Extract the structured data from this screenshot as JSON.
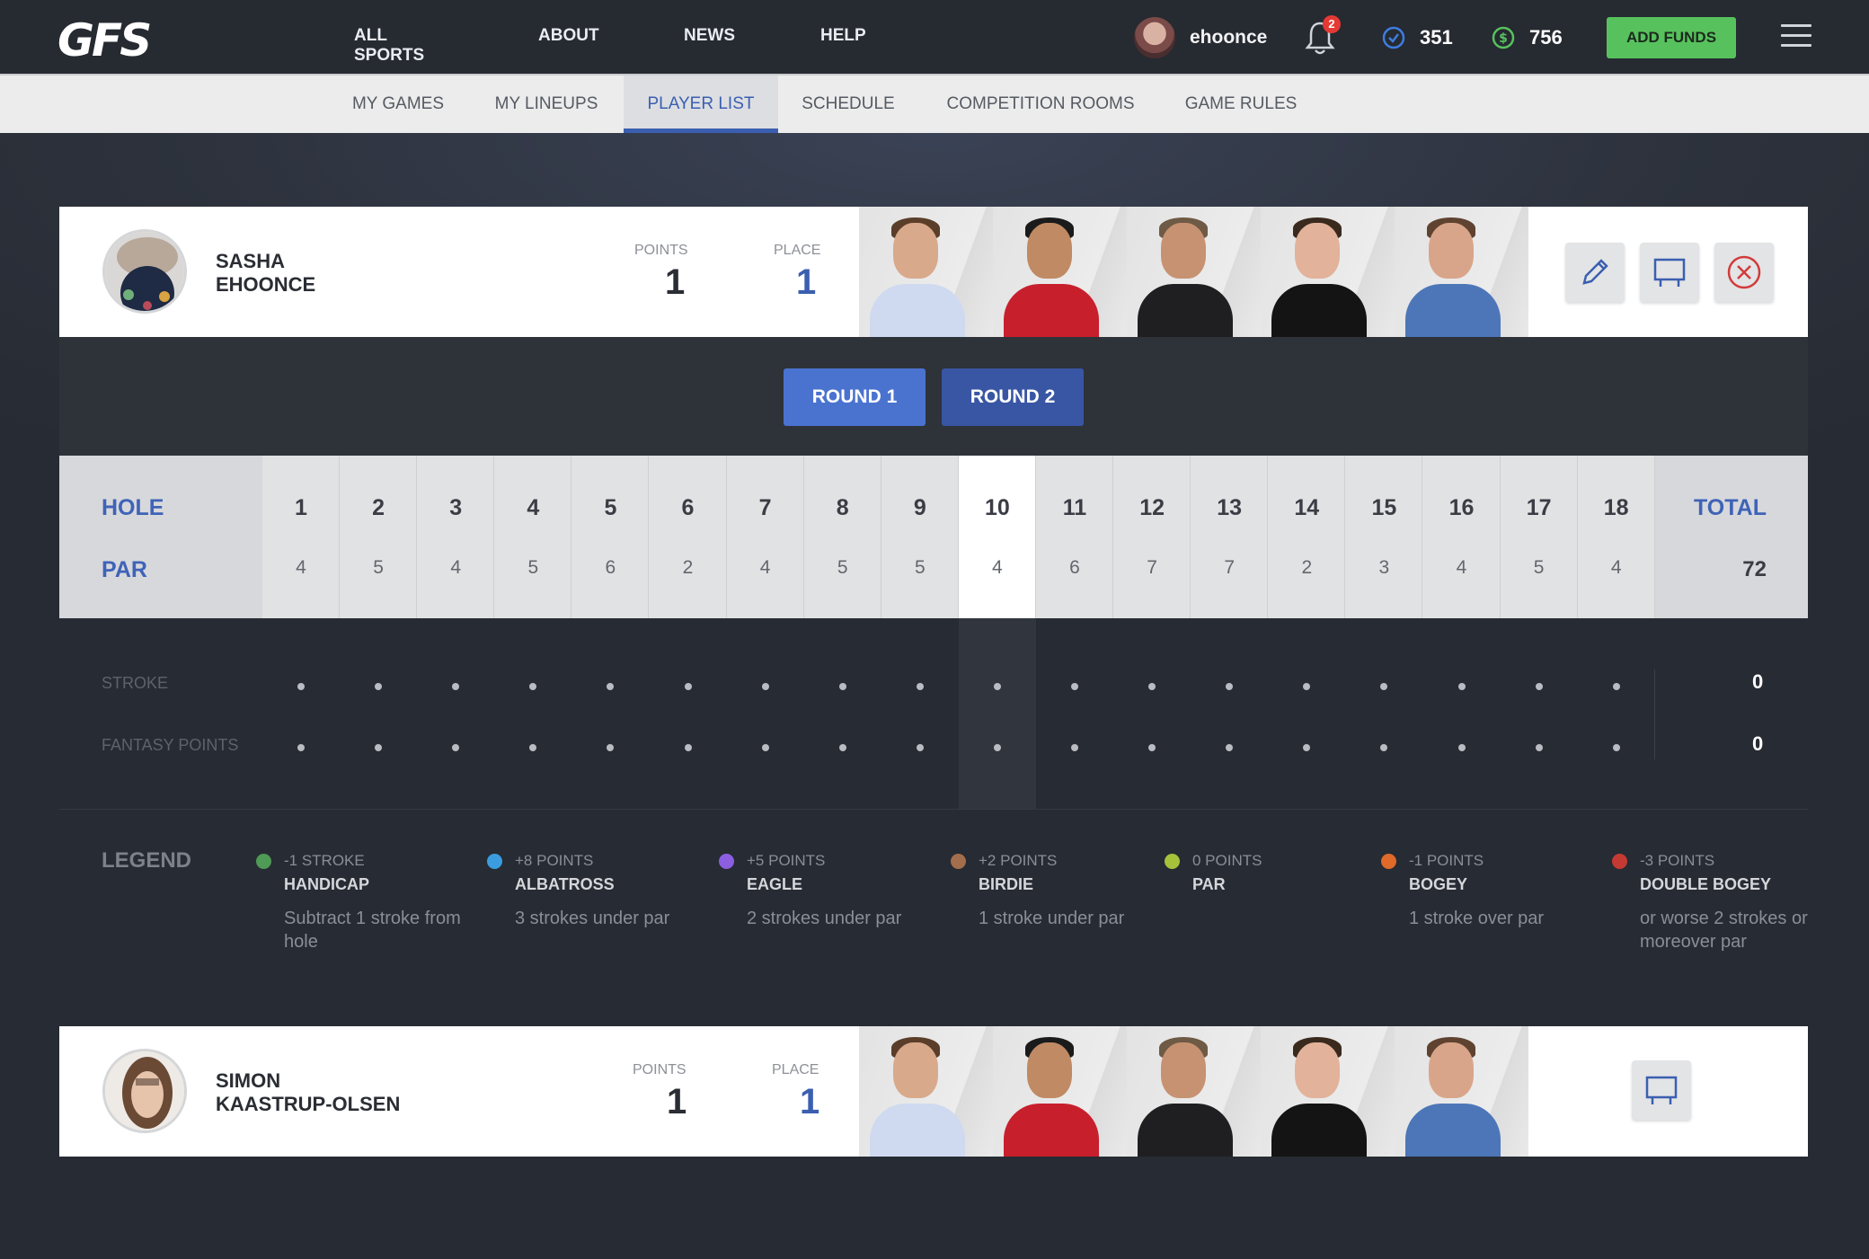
{
  "header": {
    "logo": "GFS",
    "nav": [
      "ALL SPORTS",
      "ABOUT",
      "NEWS",
      "HELP"
    ],
    "username": "ehoonce",
    "notifications": "2",
    "points_balance": "351",
    "cash_balance": "756",
    "add_funds": "ADD FUNDS"
  },
  "subnav": {
    "tabs": [
      "MY GAMES",
      "MY LINEUPS",
      "PLAYER LIST",
      "SCHEDULE",
      "COMPETITION ROOMS",
      "GAME RULES"
    ],
    "active": "PLAYER LIST"
  },
  "lineups": [
    {
      "first": "SASHA",
      "last": "EHOONCE",
      "points_label": "POINTS",
      "points": "1",
      "place_label": "PLACE",
      "place": "1"
    },
    {
      "first": "SIMON",
      "last": "KAASTRUP-OLSEN",
      "points_label": "POINTS",
      "points": "1",
      "place_label": "PLACE",
      "place": "1"
    }
  ],
  "rounds": {
    "round1": "ROUND 1",
    "round2": "ROUND 2",
    "active": "ROUND 1"
  },
  "scorecard": {
    "hole_label": "HOLE",
    "par_label": "PAR",
    "total_label": "TOTAL",
    "par_total": "72",
    "holes": [
      "1",
      "2",
      "3",
      "4",
      "5",
      "6",
      "7",
      "8",
      "9",
      "10",
      "11",
      "12",
      "13",
      "14",
      "15",
      "16",
      "17",
      "18"
    ],
    "pars": [
      "4",
      "5",
      "4",
      "5",
      "6",
      "2",
      "4",
      "5",
      "5",
      "4",
      "6",
      "7",
      "7",
      "2",
      "3",
      "4",
      "5",
      "4"
    ],
    "highlight_hole": "10",
    "stroke_label": "STROKE",
    "fantasy_label": "FANTASY POINTS",
    "stroke_total": "0",
    "fantasy_total": "0"
  },
  "legend": {
    "title": "LEGEND",
    "items": [
      {
        "value": "-1 STROKE",
        "name": "HANDICAP",
        "desc": "Subtract 1 stroke from hole",
        "color": "#4f9a55"
      },
      {
        "value": "+8 POINTS",
        "name": "ALBATROSS",
        "desc": "3 strokes under par",
        "color": "#3b9de0"
      },
      {
        "value": "+5 POINTS",
        "name": "EAGLE",
        "desc": "2 strokes under par",
        "color": "#8b5fe0"
      },
      {
        "value": "+2 POINTS",
        "name": "BIRDIE",
        "desc": "1 stroke under par",
        "color": "#a36e4c"
      },
      {
        "value": "0 POINTS",
        "name": "PAR",
        "desc": "",
        "color": "#a5c23a"
      },
      {
        "value": "-1 POINTS",
        "name": "BOGEY",
        "desc": "1 stroke over par",
        "color": "#e06a2a"
      },
      {
        "value": "-3 POINTS",
        "name": "DOUBLE BOGEY",
        "desc": "or worse 2 strokes or moreover par",
        "color": "#c43a33"
      }
    ]
  },
  "colors": {
    "accent": "#3b5fb0",
    "addfunds": "#57c25d",
    "badge": "#e53935"
  }
}
